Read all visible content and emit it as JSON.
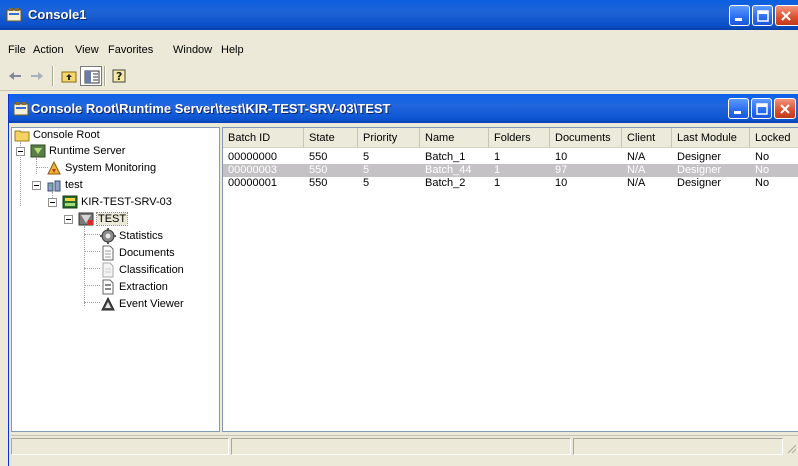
{
  "app": {
    "title": "Console1"
  },
  "menu": {
    "items": [
      "File",
      "Action",
      "View",
      "Favorites",
      "Window",
      "Help"
    ]
  },
  "toolbar": {
    "icons": [
      "back-arrow-icon",
      "forward-arrow-icon",
      "up-one-level-icon",
      "show-hide-tree-icon",
      "help-icon"
    ]
  },
  "child_window": {
    "title": "Console Root\\Runtime Server\\test\\KIR-TEST-SRV-03\\TEST"
  },
  "tree": {
    "nodes": [
      {
        "label": "Console Root",
        "icon": "folder-icon"
      },
      {
        "label": "Runtime Server",
        "icon": "runtime-server-icon"
      },
      {
        "label": "System Monitoring",
        "icon": "system-monitoring-icon"
      },
      {
        "label": "test",
        "icon": "server-group-icon"
      },
      {
        "label": "KIR-TEST-SRV-03",
        "icon": "server-icon"
      },
      {
        "label": "TEST",
        "icon": "project-icon"
      },
      {
        "label": "Statistics",
        "icon": "statistics-gear-icon"
      },
      {
        "label": "Documents",
        "icon": "document-icon"
      },
      {
        "label": "Classification",
        "icon": "classification-icon"
      },
      {
        "label": "Extraction",
        "icon": "extraction-icon"
      },
      {
        "label": "Event Viewer",
        "icon": "event-viewer-icon"
      }
    ]
  },
  "list": {
    "columns": [
      "Batch ID",
      "State",
      "Priority",
      "Name",
      "Folders",
      "Documents",
      "Client",
      "Last Module",
      "Locked"
    ],
    "rows": [
      [
        "00000000",
        "550",
        "5",
        "Batch_1",
        "1",
        "10",
        "N/A",
        "Designer",
        "No"
      ],
      [
        "00000003",
        "550",
        "5",
        "Batch_44",
        "1",
        "97",
        "N/A",
        "Designer",
        "No"
      ],
      [
        "00000001",
        "550",
        "5",
        "Batch_2",
        "1",
        "10",
        "N/A",
        "Designer",
        "No"
      ]
    ],
    "selected_row_index": 1
  },
  "colors": {
    "titlebar_blue": "#0a5fe0",
    "close_red": "#d9502f",
    "selected_row": "#c4c2c4"
  }
}
